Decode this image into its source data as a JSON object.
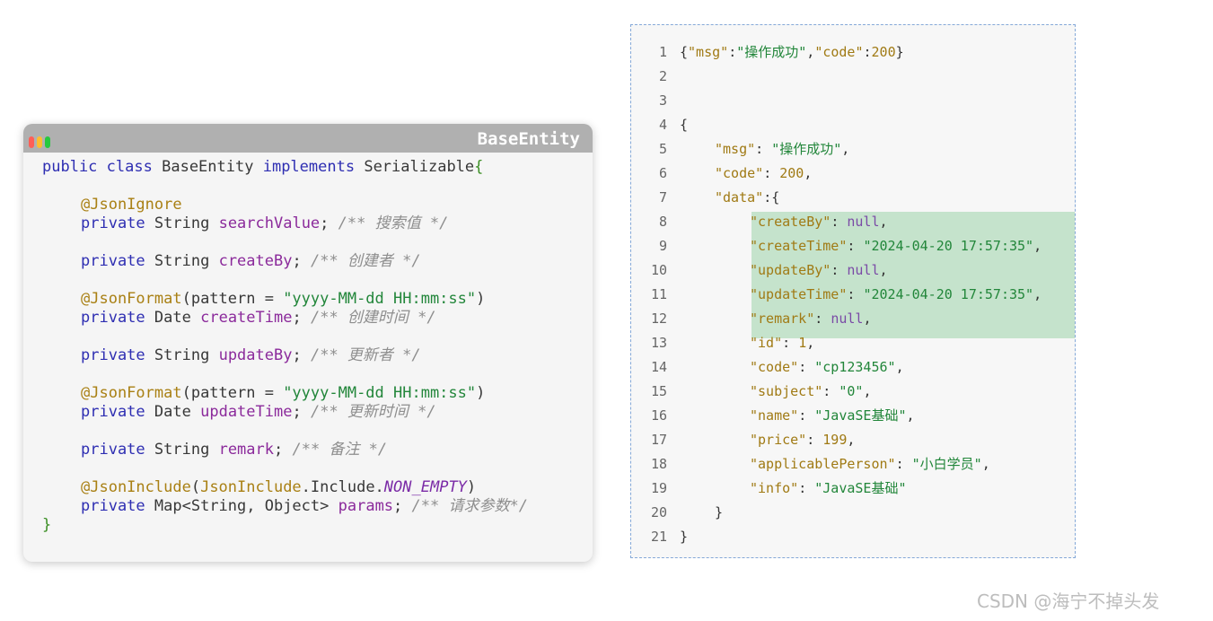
{
  "card": {
    "title": "BaseEntity",
    "code": {
      "l1": {
        "a": "public",
        "b": "class",
        "c": "BaseEntity",
        "d": "implements",
        "e": "Serializable",
        "f": "{"
      },
      "l3": "@JsonIgnore",
      "l4": {
        "a": "private",
        "b": "String",
        "c": "searchValue",
        "d": ";",
        "e": "/** 搜索值 */"
      },
      "l6": {
        "a": "private",
        "b": "String",
        "c": "createBy",
        "d": ";",
        "e": "/** 创建者 */"
      },
      "l8": {
        "a": "@JsonFormat",
        "b": "(pattern = ",
        "c": "\"yyyy-MM-dd HH:mm:ss\"",
        "d": ")"
      },
      "l9": {
        "a": "private",
        "b": "Date",
        "c": "createTime",
        "d": ";",
        "e": "/** 创建时间 */"
      },
      "l11": {
        "a": "private",
        "b": "String",
        "c": "updateBy",
        "d": ";",
        "e": "/** 更新者 */"
      },
      "l13": {
        "a": "@JsonFormat",
        "b": "(pattern = ",
        "c": "\"yyyy-MM-dd HH:mm:ss\"",
        "d": ")"
      },
      "l14": {
        "a": "private",
        "b": "Date",
        "c": "updateTime",
        "d": ";",
        "e": "/** 更新时间 */"
      },
      "l16": {
        "a": "private",
        "b": "String",
        "c": "remark",
        "d": ";",
        "e": "/** 备注 */"
      },
      "l18": {
        "a": "@JsonInclude",
        "b": "(",
        "c": "JsonInclude",
        "d": ".Include.",
        "e": "NON_EMPTY",
        "f": ")"
      },
      "l19": {
        "a": "private",
        "b": "Map<String, Object>",
        "c": "params",
        "d": ";",
        "e": "/** 请求参数*/"
      },
      "l20": "}"
    }
  },
  "json": {
    "line_numbers": [
      "1",
      "2",
      "3",
      "4",
      "5",
      "6",
      "7",
      "8",
      "9",
      "10",
      "11",
      "12",
      "13",
      "14",
      "15",
      "16",
      "17",
      "18",
      "19",
      "20",
      "21"
    ],
    "line1": {
      "open": "{",
      "k1": "\"msg\"",
      "c1": ":",
      "v1": "\"操作成功\"",
      "sep": ",",
      "k2": "\"code\"",
      "c2": ":",
      "v2": "200",
      "close": "}"
    },
    "line4": "{",
    "msg": {
      "key": "\"msg\"",
      "colon": ": ",
      "value": "\"操作成功\"",
      "comma": ","
    },
    "code": {
      "key": "\"code\"",
      "colon": ": ",
      "value": "200",
      "comma": ","
    },
    "data_open": {
      "key": "\"data\"",
      "colon": ":{"
    },
    "createBy": {
      "key": "\"createBy\"",
      "colon": ": ",
      "value": "null",
      "comma": ","
    },
    "createTime": {
      "key": "\"createTime\"",
      "colon": ": ",
      "value": "\"2024-04-20 17:57:35\"",
      "comma": ","
    },
    "updateBy": {
      "key": "\"updateBy\"",
      "colon": ": ",
      "value": "null",
      "comma": ","
    },
    "updateTime": {
      "key": "\"updateTime\"",
      "colon": ": ",
      "value": "\"2024-04-20 17:57:35\"",
      "comma": ","
    },
    "remark": {
      "key": "\"remark\"",
      "colon": ": ",
      "value": "null",
      "comma": ","
    },
    "id": {
      "key": "\"id\"",
      "colon": ": ",
      "value": "1",
      "comma": ","
    },
    "course_code": {
      "key": "\"code\"",
      "colon": ": ",
      "value": "\"cp123456\"",
      "comma": ","
    },
    "subject": {
      "key": "\"subject\"",
      "colon": ": ",
      "value": "\"0\"",
      "comma": ","
    },
    "name": {
      "key": "\"name\"",
      "colon": ": ",
      "value": "\"JavaSE基础\"",
      "comma": ","
    },
    "price": {
      "key": "\"price\"",
      "colon": ": ",
      "value": "199",
      "comma": ","
    },
    "applicablePerson": {
      "key": "\"applicablePerson\"",
      "colon": ": ",
      "value": "\"小白学员\"",
      "comma": ","
    },
    "info": {
      "key": "\"info\"",
      "colon": ": ",
      "value": "\"JavaSE基础\""
    },
    "data_close": "}",
    "close": "}"
  },
  "watermark": "CSDN @海宁不掉头发",
  "colors": {
    "keyword": "#2e2eb2",
    "annotation": "#a98014",
    "field": "#8b2a9b",
    "string": "#22863a",
    "comment": "#8e8e8e",
    "highlight": "#c5e3cc"
  }
}
